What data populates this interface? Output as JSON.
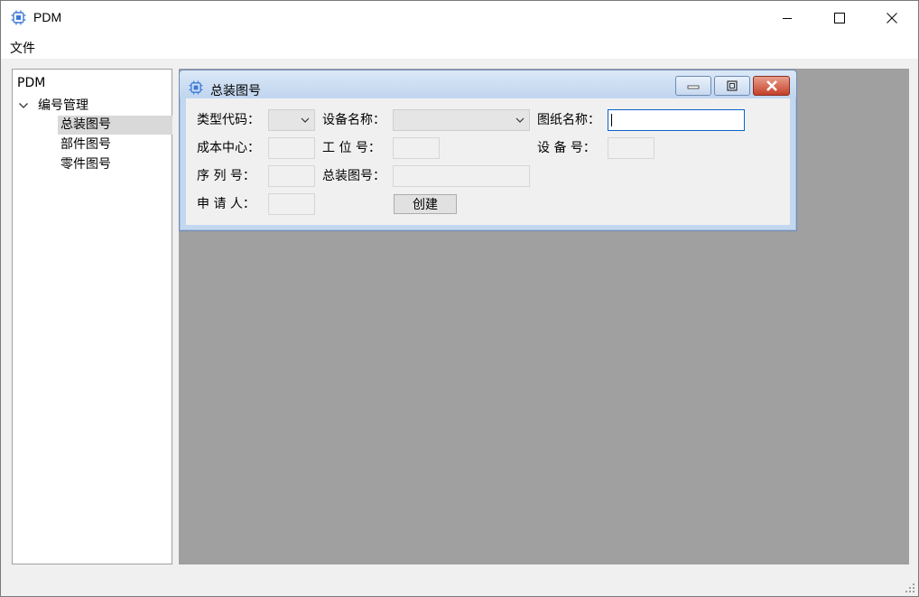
{
  "app": {
    "title": "PDM"
  },
  "menu": {
    "file_label": "文件"
  },
  "tree": {
    "root": "PDM",
    "group": "编号管理",
    "children": [
      "总装图号",
      "部件图号",
      "零件图号"
    ]
  },
  "subwindow": {
    "title": "总装图号",
    "labels": {
      "type_code": "类型代码：",
      "device_name": "设备名称：",
      "drawing_name": "图纸名称：",
      "cost_center": "成本中心：",
      "station_no": "工 位 号：",
      "device_no": "设 备 号：",
      "serial_no": "序 列 号：",
      "assembly_no": "总装图号：",
      "applicant": "申 请 人："
    },
    "values": {
      "type_code": "",
      "device_name": "",
      "drawing_name": "",
      "cost_center": "",
      "station_no": "",
      "device_no": "",
      "serial_no": "",
      "assembly_no": "",
      "applicant": ""
    },
    "create_button": "创建"
  },
  "colors": {
    "mdi_background": "#a0a0a0",
    "subwindow_frame": "#c3d7ef",
    "focus_border": "#0a64c8",
    "close_button": "#c4402a"
  }
}
